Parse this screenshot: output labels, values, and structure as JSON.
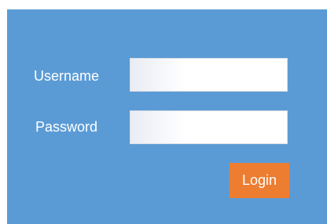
{
  "login_form": {
    "username_label": "Username",
    "password_label": "Password",
    "username_value": "",
    "password_value": "",
    "login_label": "Login"
  },
  "colors": {
    "panel_background": "#5b9bd5",
    "login_button": "#ed7d31",
    "label_text": "#ffffff"
  }
}
